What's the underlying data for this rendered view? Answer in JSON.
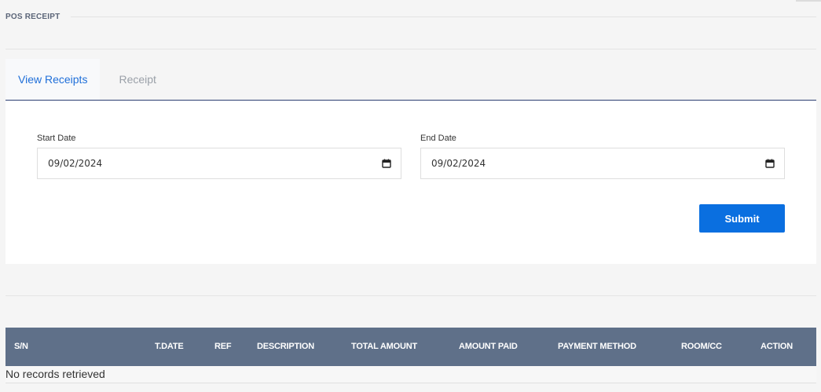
{
  "page": {
    "title": "POS RECEIPT"
  },
  "tabs": [
    {
      "label": "View Receipts",
      "active": true
    },
    {
      "label": "Receipt",
      "active": false
    }
  ],
  "form": {
    "start_date_label": "Start Date",
    "start_date_value": "09/02/2024",
    "end_date_label": "End Date",
    "end_date_value": "09/02/2024",
    "submit_label": "Submit"
  },
  "table": {
    "columns": [
      "S/N",
      "T.DATE",
      "REF",
      "DESCRIPTION",
      "TOTAL AMOUNT",
      "AMOUNT PAID",
      "PAYMENT METHOD",
      "ROOM/CC",
      "ACTION"
    ],
    "empty_text": "No records retrieved"
  },
  "icons": {
    "date_picker": "calendar-icon"
  },
  "colors": {
    "accent": "#1f6fd9",
    "button": "#0a6fe0",
    "table_header": "#5f7089",
    "tab_underline": "#2c3e72"
  }
}
